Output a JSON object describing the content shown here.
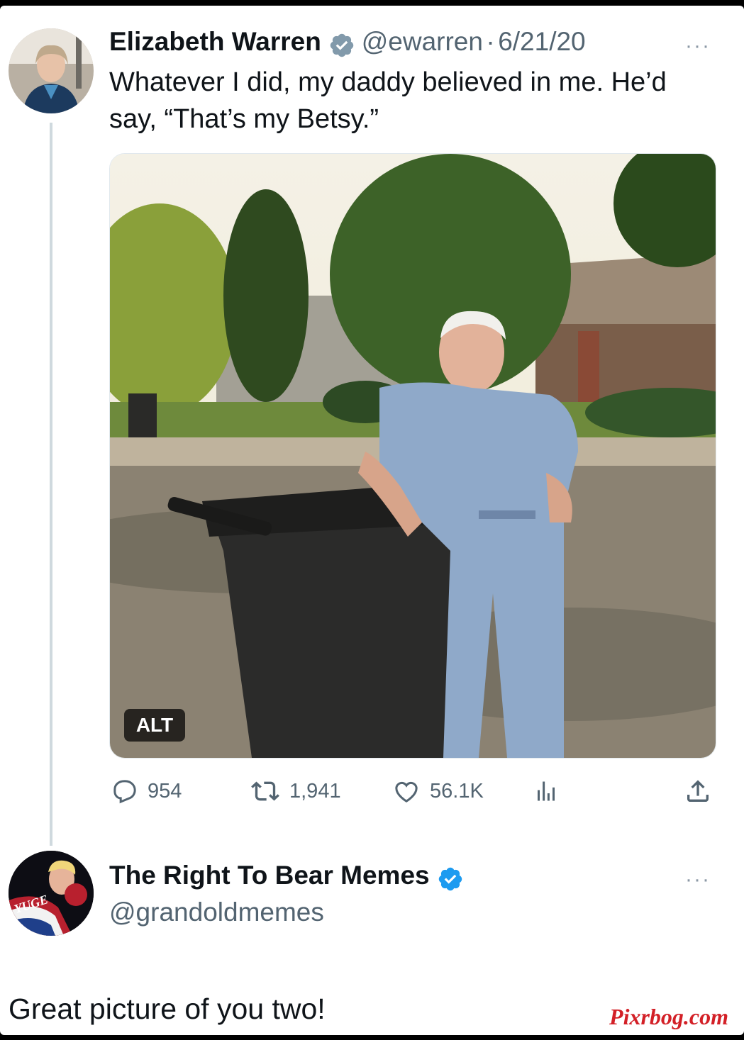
{
  "tweet": {
    "author_name": "Elizabeth Warren",
    "handle": "@ewarren",
    "separator": "·",
    "date": "6/21/20",
    "text_line1": "Whatever I did, my daddy believed in me. He’d",
    "text_line2": "say, “That’s my Betsy.”",
    "more_label": "···",
    "alt_label": "ALT",
    "actions": {
      "replies": "954",
      "retweets": "1,941",
      "likes": "56.1K"
    },
    "icons": [
      "verified-badge-icon",
      "reply-icon",
      "retweet-icon",
      "like-icon",
      "views-icon",
      "share-icon",
      "more-icon"
    ]
  },
  "reply": {
    "author_name": "The Right To Bear Memes",
    "handle": "@grandoldmemes",
    "more_label": "···",
    "avatar_text": "YUGE",
    "text": "Great picture of you two!"
  },
  "watermark": "Pixrbog.com",
  "colors": {
    "verified_blue": "#1d9bf0",
    "verified_gray": "#829aab",
    "text": "#0f1419",
    "secondary": "#536471",
    "watermark": "#d32027"
  }
}
